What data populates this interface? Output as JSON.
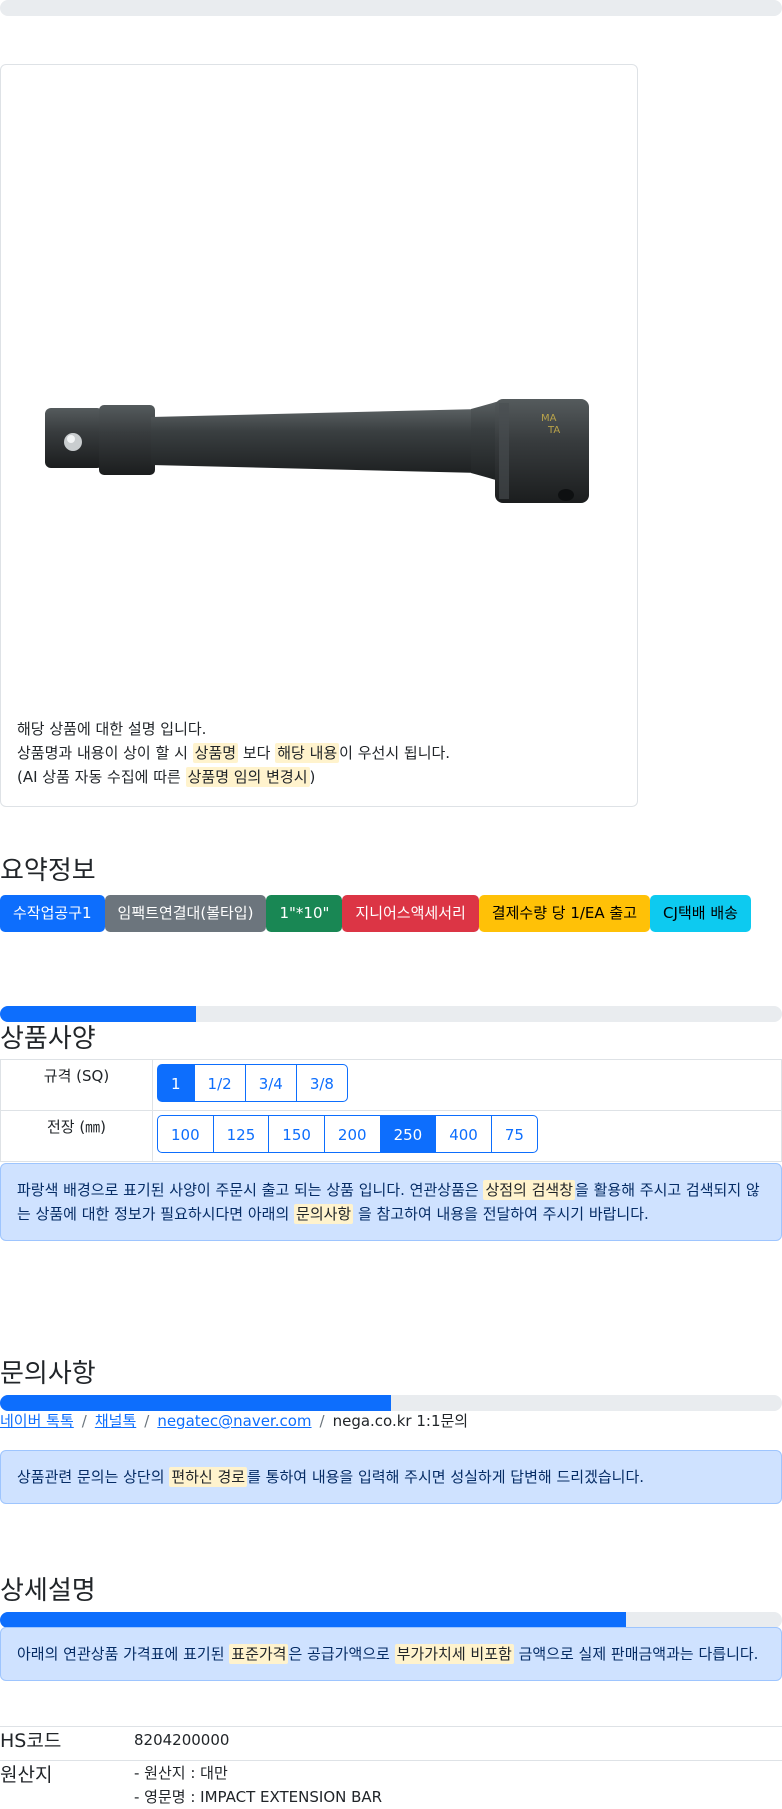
{
  "description": {
    "line1": "해당 상품에 대한 설명 입니다.",
    "line2_a": "상품명과 내용이 상이 할 시 ",
    "line2_mark1": "상품명",
    "line2_b": " 보다 ",
    "line2_mark2": "해당 내용",
    "line2_c": "이 우선시 됩니다.",
    "line3_a": "(AI 상품 자동 수집에 따른 ",
    "line3_mark": "상품명 임의 변경시",
    "line3_b": ")"
  },
  "summary": {
    "title": "요약정보",
    "badges": [
      "수작업공구1",
      "임팩트연결대(볼타입)",
      "1\"*10\"",
      "지니어스액세서리",
      "결제수량 당 1/EA 출고",
      "CJ택배 배송"
    ],
    "colors": {
      "blue": "#0d6efd",
      "gray": "#6c757d",
      "green": "#198754",
      "red": "#dc3545",
      "yellow": "#ffc107",
      "cyan": "#0dcaf0"
    }
  },
  "specs": {
    "title": "상품사양",
    "progress_percent": 25,
    "rows": [
      {
        "label": "규격 (SQ)",
        "options": [
          "1",
          "1/2",
          "3/4",
          "3/8"
        ],
        "selected": 0
      },
      {
        "label": "전장 (㎜)",
        "options": [
          "100",
          "125",
          "150",
          "200",
          "250",
          "400",
          "75"
        ],
        "selected": 4
      }
    ],
    "notice_a": "파랑색 배경으로 표기된 사양이 주문시 출고 되는 상품 입니다. 연관상품은 ",
    "notice_mark1": "상점의 검색창",
    "notice_b": "을 활용해 주시고 검색되지 않는 상품에 대한 정보가 필요하시다면 아래의 ",
    "notice_mark2": "문의사항",
    "notice_c": " 을 참고하여 내용을 전달하여 주시기 바랍니다."
  },
  "inquiry": {
    "title": "문의사항",
    "progress_percent": 50,
    "links": [
      "네이버 톡톡",
      "채널톡",
      "negatec@naver.com"
    ],
    "plain": "nega.co.kr 1:1문의",
    "separator": "/",
    "notice_a": "상품관련 문의는 상단의 ",
    "notice_mark": "편하신 경로",
    "notice_b": "를 통하여 내용을 입력해 주시면 성실하게 답변해 드리겠습니다."
  },
  "detail": {
    "title": "상세설명",
    "progress_percent": 80,
    "notice_a": "아래의 연관상품 가격표에 표기된 ",
    "notice_mark1": "표준가격",
    "notice_b": "은 공급가액으로 ",
    "notice_mark2": "부가가치세 비포함",
    "notice_c": " 금액으로 실제 판매금액과는 다릅니다."
  },
  "info": {
    "hs_label": "HS코드",
    "hs_value": "8204200000",
    "origin_label": "원산지",
    "origin_line1": "- 원산지 : 대만",
    "origin_line2": "- 영문명 : IMPACT EXTENSION BAR"
  }
}
